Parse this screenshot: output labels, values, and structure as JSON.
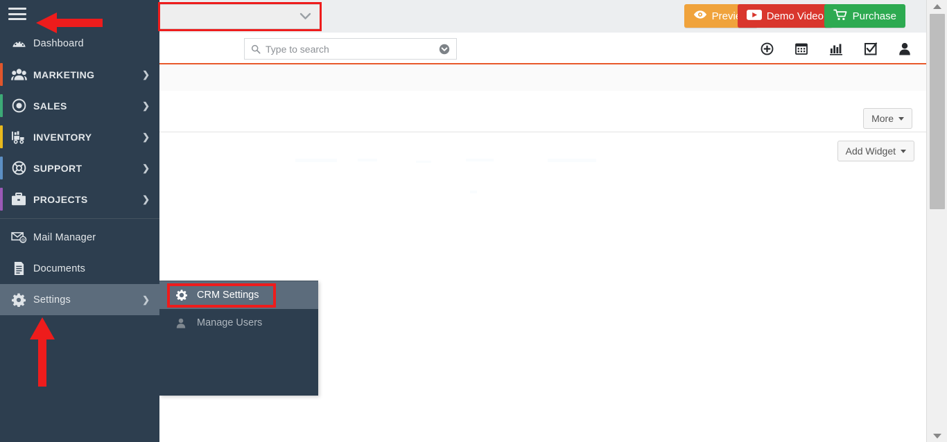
{
  "app": {
    "accent_orange": "#e8582a",
    "sidebar_bg": "#2d3e4f",
    "sidebar_active": "#5c6c7c"
  },
  "topbar": {
    "module_select": {
      "value": "",
      "placeholder": "",
      "icon": "chevron-down-icon"
    },
    "buttons": [
      {
        "id": "preview",
        "label": "Preview",
        "icon": "eye-icon",
        "color": "#f0a33c"
      },
      {
        "id": "demo",
        "label": "Demo Video",
        "icon": "play-icon",
        "color": "#d9362d"
      },
      {
        "id": "purchase",
        "label": "Purchase",
        "icon": "cart-icon",
        "color": "#2daa51"
      }
    ]
  },
  "search": {
    "value": "",
    "placeholder": "Type to search",
    "icon": "search-icon",
    "dropdown_icon": "circle-chevron-down-icon"
  },
  "top_icons": [
    {
      "id": "add",
      "name": "plus-circle-icon"
    },
    {
      "id": "calendar",
      "name": "calendar-icon"
    },
    {
      "id": "reports",
      "name": "bar-chart-icon"
    },
    {
      "id": "tasks",
      "name": "checkbox-icon"
    },
    {
      "id": "user",
      "name": "user-icon"
    }
  ],
  "sidebar": {
    "toggle": {
      "name": "hamburger-menu-icon"
    },
    "items": [
      {
        "label": "Dashboard",
        "icon": "dashboard-icon",
        "accent": "",
        "caps": false,
        "arrow": false,
        "active": false
      },
      {
        "label": "MARKETING",
        "icon": "users-icon",
        "accent": "#e0562c",
        "caps": true,
        "arrow": true,
        "active": false
      },
      {
        "label": "SALES",
        "icon": "target-icon",
        "accent": "#3daa77",
        "caps": true,
        "arrow": true,
        "active": false
      },
      {
        "label": "INVENTORY",
        "icon": "truck-icon",
        "accent": "#e8b91e",
        "caps": true,
        "arrow": true,
        "active": false
      },
      {
        "label": "SUPPORT",
        "icon": "lifering-icon",
        "accent": "#5c8fc4",
        "caps": true,
        "arrow": true,
        "active": false
      },
      {
        "label": "PROJECTS",
        "icon": "briefcase-icon",
        "accent": "#9b59b6",
        "caps": true,
        "arrow": true,
        "active": false
      }
    ],
    "items_lower": [
      {
        "label": "Mail Manager",
        "icon": "mail-at-icon",
        "accent": "",
        "caps": false,
        "arrow": false,
        "active": false
      },
      {
        "label": "Documents",
        "icon": "document-icon",
        "accent": "",
        "caps": false,
        "arrow": false,
        "active": false
      },
      {
        "label": "Settings",
        "icon": "gear-icon",
        "accent": "",
        "caps": false,
        "arrow": true,
        "active": true
      }
    ],
    "arrow_glyph": "❯"
  },
  "submenu": {
    "items": [
      {
        "label": "CRM Settings",
        "icon": "gear-icon",
        "active": true
      },
      {
        "label": "Manage Users",
        "icon": "user-icon",
        "active": false
      }
    ]
  },
  "content": {
    "more_button": "More",
    "add_widget_button": "Add Widget"
  },
  "annotations": {
    "arrow_color": "#ee1c1c",
    "highlight_color": "#ee1c1c",
    "arrow_top_target": "hamburger-menu-icon",
    "arrow_bottom_target": "sidebar-item-settings",
    "box_targets": [
      "module-select",
      "submenu-item-crm-settings"
    ]
  }
}
